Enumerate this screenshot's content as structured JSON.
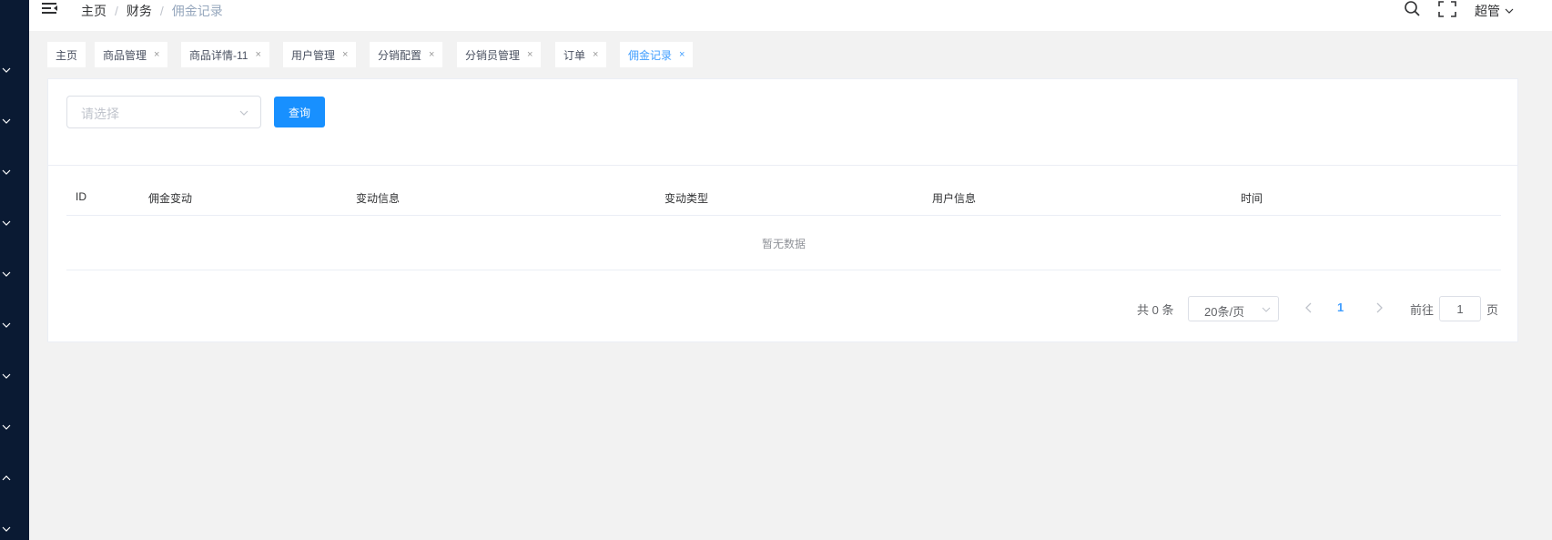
{
  "breadcrumb": [
    "主页",
    "财务",
    "佣金记录"
  ],
  "header": {
    "user_name": "超管"
  },
  "tags": [
    {
      "label": "主页",
      "closable": false,
      "active": false
    },
    {
      "label": "商品管理",
      "closable": true,
      "active": false
    },
    {
      "label": "商品详情-11",
      "closable": true,
      "active": false
    },
    {
      "label": "用户管理",
      "closable": true,
      "active": false
    },
    {
      "label": "分销配置",
      "closable": true,
      "active": false
    },
    {
      "label": "分销员管理",
      "closable": true,
      "active": false
    },
    {
      "label": "订单",
      "closable": true,
      "active": false
    },
    {
      "label": "佣金记录",
      "closable": true,
      "active": true
    }
  ],
  "filter": {
    "select_placeholder": "请选择",
    "query_label": "查询"
  },
  "table": {
    "columns": [
      "ID",
      "佣金变动",
      "变动信息",
      "变动类型",
      "用户信息",
      "时间"
    ],
    "empty_text": "暂无数据"
  },
  "pagination": {
    "total_label": "共 0 条",
    "page_size": "20条/页",
    "current_page": "1",
    "goto_label": "前往",
    "goto_value": "1",
    "page_suffix": "页"
  },
  "icons": {
    "menu": "menu-fold-icon",
    "search": "search-icon",
    "fullscreen": "fullscreen-icon",
    "user_caret": "chevron-down-icon",
    "sidebar_toggles": [
      "chevron-down-icon",
      "chevron-down-icon",
      "chevron-down-icon",
      "chevron-down-icon",
      "chevron-down-icon",
      "chevron-down-icon",
      "chevron-down-icon",
      "chevron-down-icon",
      "chevron-up-icon",
      "chevron-down-icon"
    ]
  },
  "colors": {
    "sidebar": "#0a1a33",
    "primary": "#1890ff",
    "active_tag": "#409eff"
  }
}
